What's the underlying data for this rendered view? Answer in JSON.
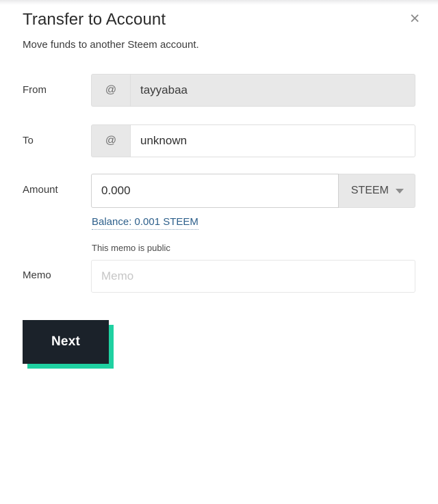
{
  "dialog": {
    "title": "Transfer to Account",
    "subtitle": "Move funds to another Steem account.",
    "close_label": "×"
  },
  "form": {
    "from": {
      "label": "From",
      "prefix": "@",
      "value": "tayyabaa",
      "placeholder": ""
    },
    "to": {
      "label": "To",
      "prefix": "@",
      "value": "unknown",
      "placeholder": ""
    },
    "amount": {
      "label": "Amount",
      "value": "0.000",
      "placeholder": "0.000",
      "currency": "STEEM",
      "balance_text": "Balance: 0.001 STEEM"
    },
    "memo": {
      "label": "Memo",
      "hint": "This memo is public",
      "value": "",
      "placeholder": "Memo"
    }
  },
  "actions": {
    "next_label": "Next"
  },
  "colors": {
    "accent_teal": "#1fd1a1",
    "button_dark": "#1b222a",
    "link_blue": "#2d5f8b",
    "field_grey": "#e8e8e8"
  }
}
